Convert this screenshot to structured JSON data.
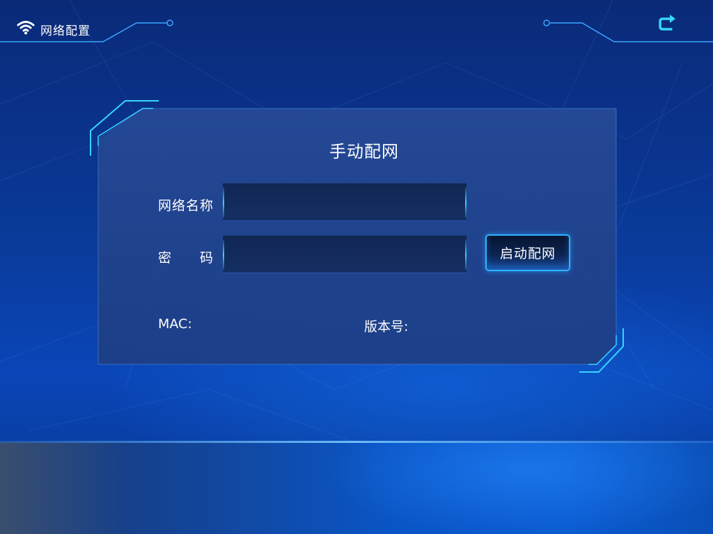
{
  "header": {
    "title": "网络配置",
    "wifi_icon": "wifi-icon",
    "back_icon": "back-arrow-icon"
  },
  "panel": {
    "title": "手动配网",
    "ssid_label": "网络名称",
    "ssid_value": "",
    "password_label_left": "密",
    "password_label_right": "码",
    "password_value": "",
    "start_button_label": "启动配网",
    "mac_label": "MAC:",
    "version_label": "版本号:"
  },
  "colors": {
    "accent": "#37d6ff",
    "background": "#0a3a9a",
    "panel": "#264a96"
  }
}
